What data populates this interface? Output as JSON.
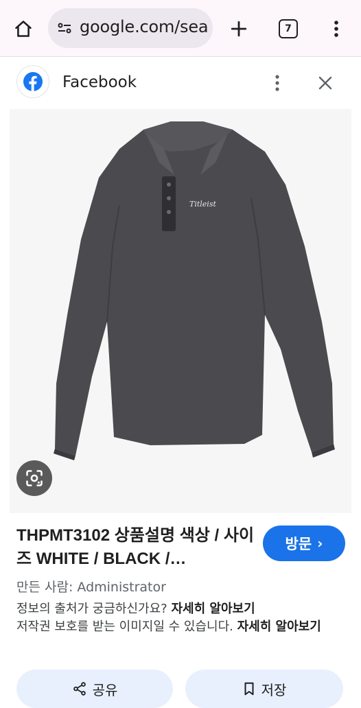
{
  "browser": {
    "url": "google.com/sea",
    "tab_count": "7"
  },
  "sheet": {
    "source_name": "Facebook"
  },
  "result": {
    "title": "THPMT3102 상품설명 색상 / 사이즈 WHITE / BLACK /…",
    "visit_label": "방문",
    "creator": "만든 사람: Administrator",
    "source_question": "정보의 출처가 궁금하신가요?",
    "learn_more": "자세히 알아보기",
    "copyright_notice": "저작권 보호를 받는 이미지일 수 있습니다.",
    "learn_more_2": "자세히 알아보기"
  },
  "actions": {
    "share_label": "공유",
    "save_label": "저장"
  },
  "image": {
    "logo_text": "Titleist"
  },
  "colors": {
    "accent": "#1a73e8",
    "facebook_blue": "#1877f2",
    "shirt": "#4a4a4f"
  }
}
